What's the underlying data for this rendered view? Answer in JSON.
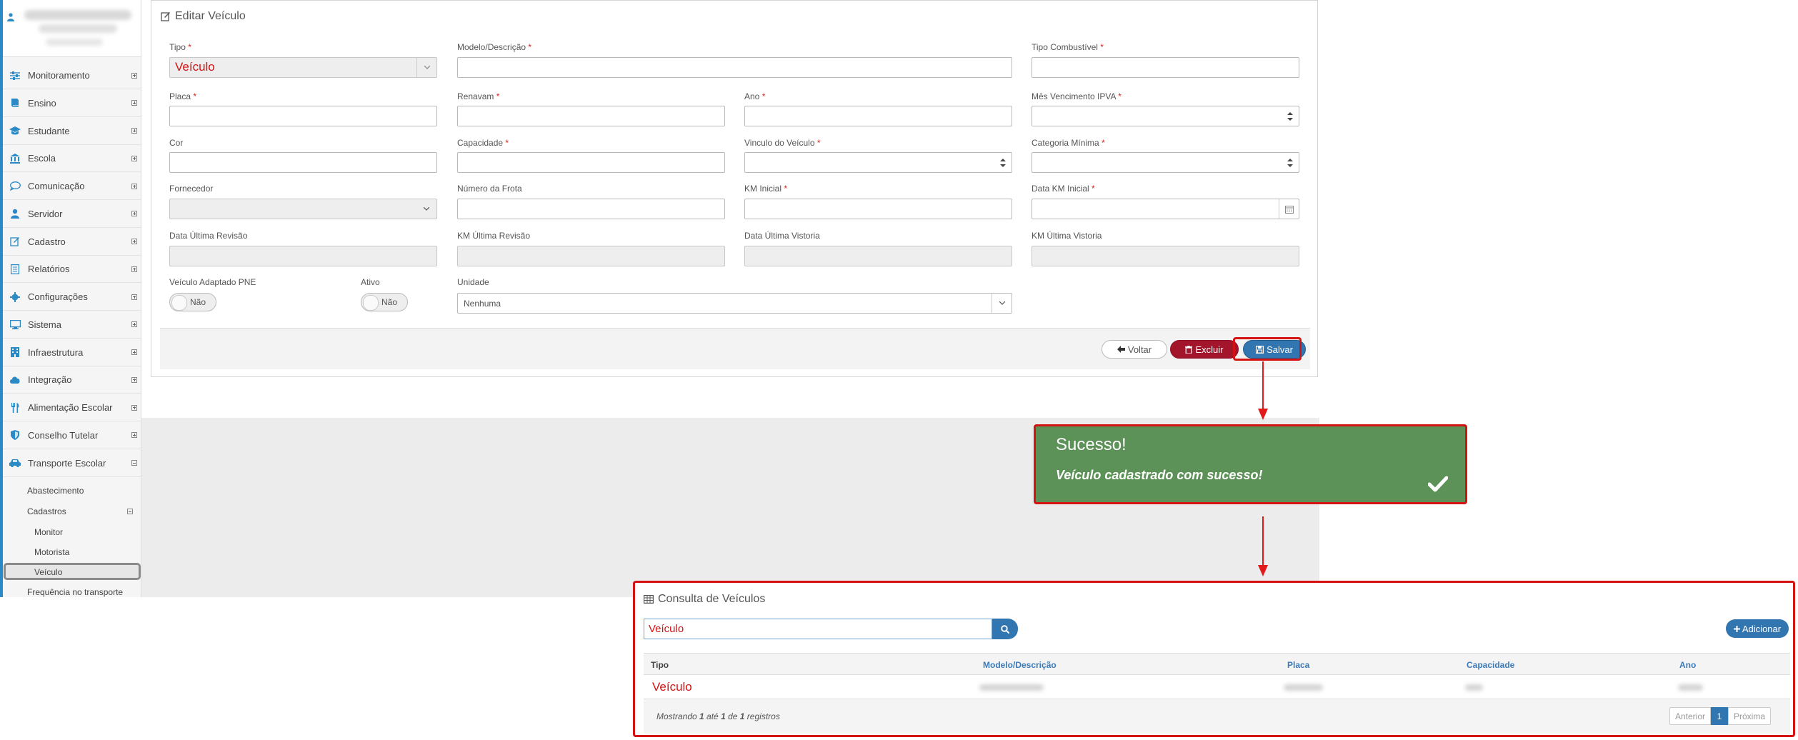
{
  "sidebar": {
    "menu": [
      {
        "label": "Monitoramento",
        "icon": "sliders-icon"
      },
      {
        "label": "Ensino",
        "icon": "book-icon"
      },
      {
        "label": "Estudante",
        "icon": "graduation-cap-icon"
      },
      {
        "label": "Escola",
        "icon": "institution-icon"
      },
      {
        "label": "Comunicação",
        "icon": "chat-bubble-icon"
      },
      {
        "label": "Servidor",
        "icon": "user-icon"
      },
      {
        "label": "Cadastro",
        "icon": "edit-icon"
      },
      {
        "label": "Relatórios",
        "icon": "report-icon"
      },
      {
        "label": "Configurações",
        "icon": "gear-icon"
      },
      {
        "label": "Sistema",
        "icon": "monitor-icon"
      },
      {
        "label": "Infraestrutura",
        "icon": "building-icon"
      },
      {
        "label": "Integração",
        "icon": "cloud-icon"
      },
      {
        "label": "Alimentação Escolar",
        "icon": "cutlery-icon"
      },
      {
        "label": "Conselho Tutelar",
        "icon": "shield-icon"
      },
      {
        "label": "Transporte Escolar",
        "icon": "car-icon"
      }
    ],
    "sub": {
      "abastecimento": "Abastecimento",
      "cadastros": "Cadastros",
      "monitor": "Monitor",
      "motorista": "Motorista",
      "veiculo": "Veículo",
      "frequencia": "Frequência no transporte"
    }
  },
  "edit": {
    "title": "Editar Veículo",
    "fields": {
      "tipo": {
        "label": "Tipo",
        "value": "Veículo"
      },
      "modelo": {
        "label": "Modelo/Descrição"
      },
      "combustivel": {
        "label": "Tipo Combustível"
      },
      "placa": {
        "label": "Placa"
      },
      "renavam": {
        "label": "Renavam"
      },
      "ano": {
        "label": "Ano"
      },
      "ipva": {
        "label": "Mês Vencimento IPVA"
      },
      "cor": {
        "label": "Cor"
      },
      "capacidade": {
        "label": "Capacidade"
      },
      "vinculo": {
        "label": "Vinculo do Veículo"
      },
      "categoria": {
        "label": "Categoria Mínima"
      },
      "fornecedor": {
        "label": "Fornecedor"
      },
      "frota": {
        "label": "Número da Frota"
      },
      "km_inicial": {
        "label": "KM Inicial"
      },
      "data_km": {
        "label": "Data KM Inicial"
      },
      "data_revisao": {
        "label": "Data Última Revisão"
      },
      "km_revisao": {
        "label": "KM Última Revisão"
      },
      "data_vistoria": {
        "label": "Data Última Vistoria"
      },
      "km_vistoria": {
        "label": "KM Última Vistoria"
      },
      "adaptado": {
        "label": "Veículo Adaptado PNE",
        "value": "Não"
      },
      "ativo": {
        "label": "Ativo",
        "value": "Não"
      },
      "unidade": {
        "label": "Unidade",
        "value": "Nenhuma"
      }
    },
    "required_mark": "*",
    "buttons": {
      "voltar": "Voltar",
      "excluir": "Excluir",
      "salvar": "Salvar"
    }
  },
  "toast": {
    "title": "Sucesso!",
    "message": "Veículo cadastrado com sucesso!"
  },
  "consulta": {
    "title": "Consulta de Veículos",
    "search_value": "Veículo",
    "add_label": "Adicionar",
    "columns": [
      "Tipo",
      "Modelo/Descrição",
      "Placa",
      "Capacidade",
      "Ano"
    ],
    "row_tipo": "Veículo",
    "footer": {
      "prefix": "Mostrando ",
      "from": "1",
      "mid1": " até ",
      "to": "1",
      "mid2": " de ",
      "total": "1",
      "suffix": " registros"
    },
    "pagination": {
      "prev": "Anterior",
      "current": "1",
      "next": "Próxima"
    }
  },
  "colors": {
    "accent": "#3276b1",
    "danger": "#a3152b",
    "success": "#5c9157",
    "highlight": "#d51212"
  }
}
